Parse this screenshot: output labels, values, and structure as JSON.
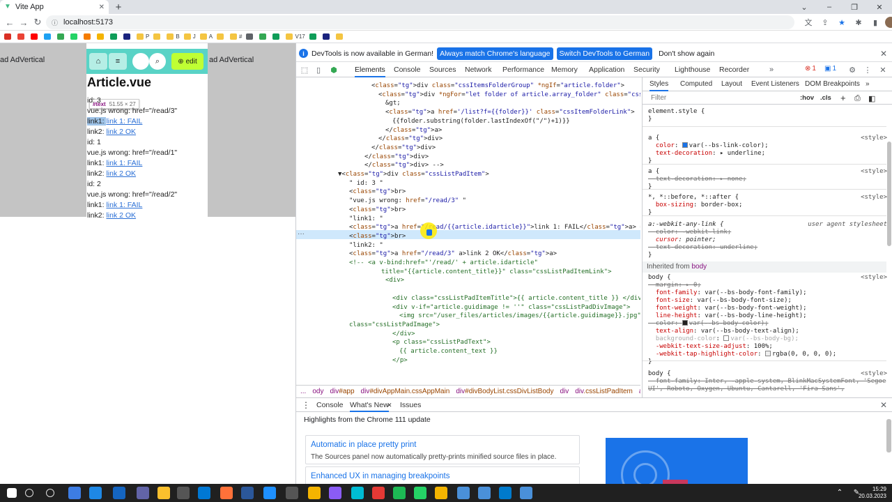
{
  "browser": {
    "tab_title": "Vite App",
    "url": "localhost:5173",
    "new_tab": "+",
    "window_controls": [
      "–",
      "❐",
      "✕"
    ],
    "bookmarks": [
      {
        "label": "",
        "color": "#d93025"
      },
      {
        "label": "",
        "color": "#ea4335"
      },
      {
        "label": "",
        "color": "#ff0000"
      },
      {
        "label": "",
        "color": "#1da1f2"
      },
      {
        "label": "",
        "color": "#34a853"
      },
      {
        "label": "",
        "color": "#25d366"
      },
      {
        "label": "",
        "color": "#f57c00"
      },
      {
        "label": "",
        "color": "#f4b400"
      },
      {
        "label": "",
        "color": "#0f9d58"
      },
      {
        "label": "",
        "color": "#1a237e"
      },
      {
        "label": "P",
        "color": "#f4c542"
      },
      {
        "label": "",
        "color": "#f4c542"
      },
      {
        "label": "B",
        "color": "#f4c542"
      },
      {
        "label": "J",
        "color": "#f4c542"
      },
      {
        "label": "A",
        "color": "#f4c542"
      },
      {
        "label": "",
        "color": "#f4c542"
      },
      {
        "label": "#",
        "color": "#f4c542"
      },
      {
        "label": "",
        "color": "#5f6368"
      },
      {
        "label": "",
        "color": "#34a853"
      },
      {
        "label": "",
        "color": "#0f9d58"
      },
      {
        "label": "V17",
        "color": "#f4c542"
      },
      {
        "label": "",
        "color": "#0f9d58"
      },
      {
        "label": "",
        "color": "#1a237e"
      },
      {
        "label": "",
        "color": "#f4c542"
      }
    ]
  },
  "page": {
    "left_text": "ad AdVertical",
    "right_text": "ad AdVertical",
    "edit_label": "edit",
    "title": "Article.vue",
    "tooltip": {
      "tag": "#text",
      "size": "51.55 × 27"
    },
    "lines": [
      {
        "text": "id: 3",
        "link": ""
      },
      {
        "text": "vue.js wrong: href=\"/read/3\"",
        "link": ""
      },
      {
        "text": "link1: ",
        "link": "link 1: FAIL"
      },
      {
        "text": "link2: ",
        "link": "link 2 OK"
      },
      {
        "text": "id: 1",
        "link": ""
      },
      {
        "text": "vue.js wrong: href=\"/read/1\"",
        "link": ""
      },
      {
        "text": "link1: ",
        "link": "link 1: FAIL"
      },
      {
        "text": "link2: ",
        "link": "link 2 OK"
      },
      {
        "text": "id: 2",
        "link": ""
      },
      {
        "text": "vue.js wrong: href=\"/read/2\"",
        "link": ""
      },
      {
        "text": "link1: ",
        "link": "link 1: FAIL"
      },
      {
        "text": "link2: ",
        "link": "link 2 OK"
      }
    ]
  },
  "devtools": {
    "infobar": {
      "message": "DevTools is now available in German!",
      "btn_match": "Always match Chrome's language",
      "btn_switch": "Switch DevTools to German",
      "btn_dismiss": "Don't show again"
    },
    "tabs": [
      "Elements",
      "Console",
      "Sources",
      "Network",
      "Performance",
      "Memory",
      "Application",
      "Security",
      "Lighthouse",
      "Recorder"
    ],
    "errors": "1",
    "infos": "1",
    "code_lines": [
      "<div class=\"cssItemsFolderGroup\" *ngIf=\"article.folder\">",
      "  <div *ngFor=\"let folder of article.array_folder\" class=\"cssItemFolder\">",
      "    &gt;",
      "    <a href='/list?f={{folder}}' class=\"cssItemFolderLink\">",
      "      {{folder.substring(folder.lastIndexOf(\"/\")+1)}}",
      "    </a>",
      "  </div>",
      "</div>",
      "</div>",
      "</div> -->",
      "▼<div class=\"cssListPadItem\">",
      "\" id: 3 \"",
      "<br>",
      "\"vue.js wrong: href=\"/read/3\" \"",
      "<br>",
      "\"link1: \"",
      "<a href=\"/read/{{article.idarticle}}\">link 1: FAIL</a> == $0",
      "<br>",
      "\"link2: \"",
      "<a href=\"/read/3\" a>link 2 OK</a>",
      "<!-- <a v-bind:href=\"'/read/' + article.idarticle\"",
      "      title=\"{{article.content_title}}\" class=\"cssListPadItemLink\">",
      "  <div>",
      "",
      "    <div class=\"cssListPadItemTitle\">{{ article.content_title }} </div>",
      "    <div v-if=\"article.guidimage != ''\" class=\"cssListPadDivImage\">",
      "      <img src=\"/user_files/articles/images/{{article.guidimage}}.jpg\"",
      "class=\"cssListPadImage\">",
      "    </div>",
      "    <p class=\"cssListPadText\">",
      "      {{ article.content_text }}",
      "    </p>"
    ],
    "breadcrumbs": [
      "...",
      "ody",
      "div#app",
      "div#divAppMain.cssAppMain",
      "div#divBodyList.cssDivListBody",
      "div",
      "div.cssListPadItem",
      "a"
    ],
    "styles_tabs": [
      "Styles",
      "Computed",
      "Layout",
      "Event Listeners",
      "DOM Breakpoints"
    ],
    "filter_placeholder": "Filter",
    "hov": ":hov",
    "cls": ".cls",
    "style_lines": [
      "element.style {",
      "}",
      "a {",
      "  color: ",
      "var(--bs-link-color);",
      "  text-decoration: ",
      "▸ underline;",
      "}",
      "a {",
      "  text-decoration: ▸ none;",
      "}",
      "*, *::before, *::after {",
      "  box-sizing: border-box;",
      "}",
      "a:-webkit-any-link {",
      "  color: -webkit-link;",
      "  cursor: pointer;",
      "  text-decoration: underline;",
      "}",
      "Inherited from",
      "body",
      "body {",
      "  margin: ▸ 0;",
      "  font-family: var(--bs-body-font-family);",
      "  font-size: var(--bs-body-font-size);",
      "  font-weight: var(--bs-body-font-weight);",
      "  line-height: var(--bs-body-line-height);",
      "  color: ",
      "var(--bs-body-color);",
      "  text-align: var(--bs-body-text-align);",
      "  background-color: ",
      "var(--bs-body-bg);",
      "  -webkit-text-size-adjust: 100%;",
      "  -webkit-tap-highlight-color: ",
      "rgba(0, 0, 0, 0);",
      "}",
      "body {",
      "  font-family: Inter, -apple-system, BlinkMacSystemFont, 'Segoe",
      "UI', Roboto, Oxygen, Ubuntu, Cantarell, 'Fira Sans',",
      "<style>",
      "user agent stylesheet"
    ],
    "drawer": {
      "tabs": [
        "Console",
        "What's New",
        "Issues"
      ],
      "highlights": "Highlights from the Chrome 111 update",
      "card1_title": "Automatic in place pretty print",
      "card1_desc": "The Sources panel now automatically pretty-prints minified source files in place.",
      "card2_title": "Enhanced UX in managing breakpoints"
    }
  },
  "taskbar": {
    "time": "15:29",
    "date": "20.03.2023"
  },
  "colors": {
    "accent": "#1a73e8",
    "navbar": "#59d3c6",
    "edit": "#bfff33"
  }
}
